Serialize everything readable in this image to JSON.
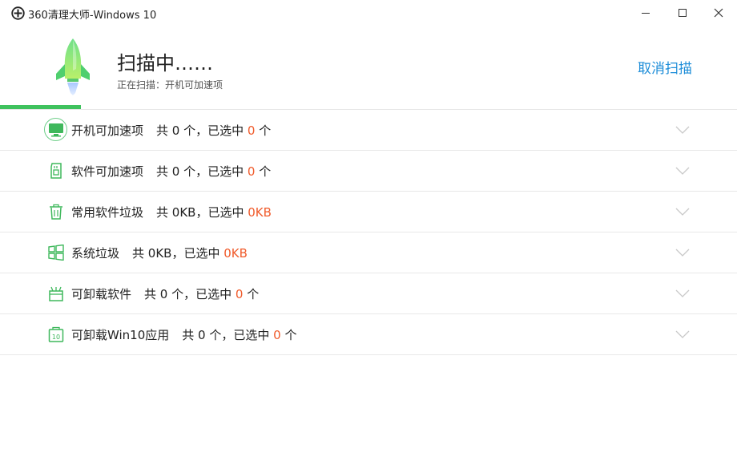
{
  "window": {
    "title": "360清理大师-Windows 10",
    "controls": {
      "minimize": "minimize-icon",
      "maximize": "maximize-icon",
      "close": "close-icon"
    }
  },
  "header": {
    "scan_title": "扫描中……",
    "scan_subtitle": "正在扫描：开机可加速项",
    "cancel_label": "取消扫描",
    "progress_percent": 11
  },
  "colors": {
    "accent_green": "#3fc25e",
    "link_blue": "#1d8dd8",
    "highlight_orange": "#f05a2a"
  },
  "items": [
    {
      "icon": "monitor-icon",
      "label": "开机可加速项",
      "prefix": "共 0 个，已选中 ",
      "selected": "0",
      "suffix": " 个"
    },
    {
      "icon": "sd-card-icon",
      "label": "软件可加速项",
      "prefix": "共 0 个，已选中 ",
      "selected": "0",
      "suffix": " 个"
    },
    {
      "icon": "trash-icon",
      "label": "常用软件垃圾",
      "prefix": "共 0KB，已选中 ",
      "selected": "0KB",
      "suffix": ""
    },
    {
      "icon": "windows-icon",
      "label": "系统垃圾",
      "prefix": "共 0KB，已选中 ",
      "selected": "0KB",
      "suffix": ""
    },
    {
      "icon": "gift-box-icon",
      "label": "可卸载软件",
      "prefix": "共 0 个，已选中 ",
      "selected": "0",
      "suffix": " 个"
    },
    {
      "icon": "win10-app-icon",
      "label": "可卸载Win10应用",
      "prefix": "共 0 个，已选中 ",
      "selected": "0",
      "suffix": " 个"
    }
  ]
}
